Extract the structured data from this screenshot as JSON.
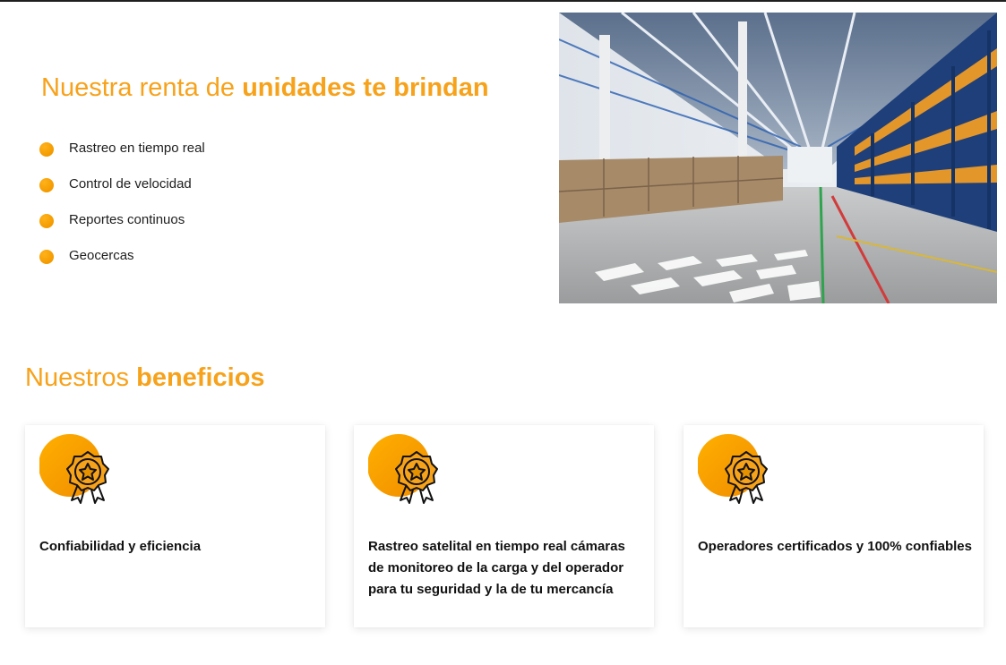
{
  "hero": {
    "title_light": "Nuestra renta de",
    "title_bold": "unidades te brindan",
    "features": [
      "Rastreo en tiempo real",
      "Control de velocidad",
      "Reportes continuos",
      "Geocercas"
    ],
    "bullet_color": "#f7a21b",
    "image_icon": "warehouse-photo"
  },
  "benefits": {
    "title_light": "Nuestros",
    "title_bold": "beneficios",
    "badge_icon": "award-medal-icon",
    "cards": [
      {
        "text": "Confiabilidad y eficiencia"
      },
      {
        "text": "Rastreo satelital en tiempo real cámaras de monitoreo de la carga y del operador para tu seguridad y la de tu mercancía"
      },
      {
        "text": "Operadores certificados y 100% confiables"
      }
    ]
  },
  "colors": {
    "accent": "#f7a21b",
    "text": "#1e1e1e",
    "card_text": "#111111"
  }
}
